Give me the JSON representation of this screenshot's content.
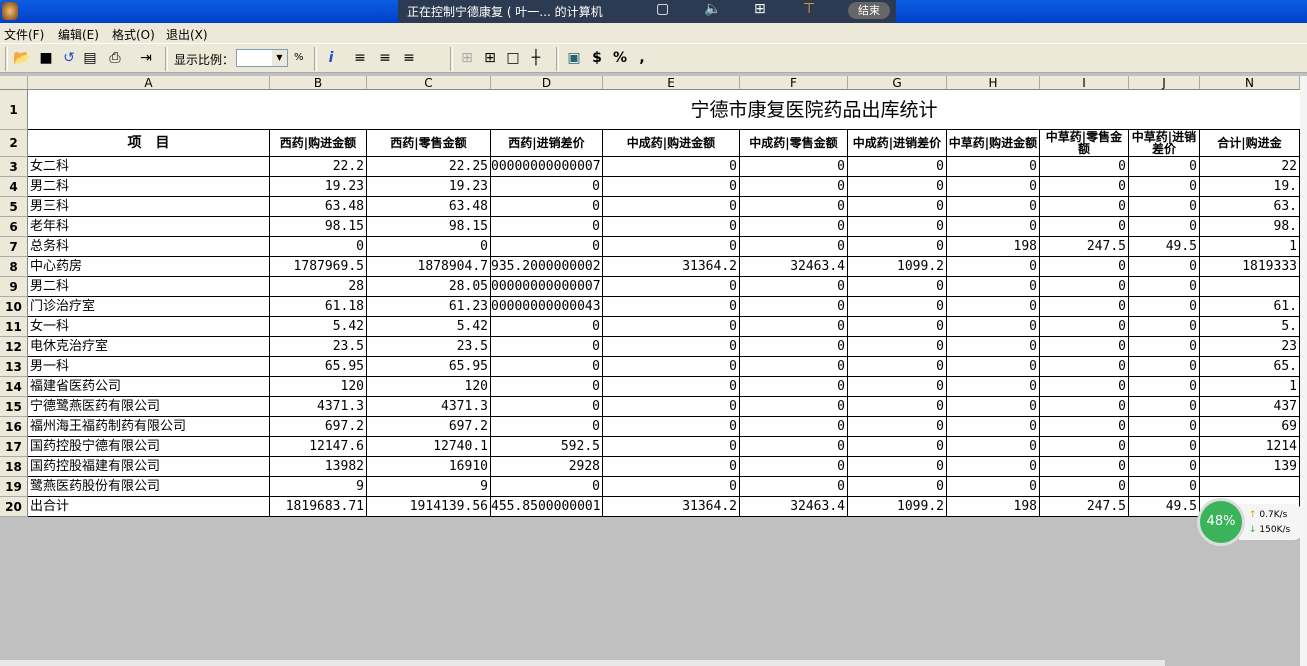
{
  "window": {
    "remote_banner": "正在控制宁德康复 ( 叶一... 的计算机",
    "end_label": "结束"
  },
  "menu": [
    "文件(F)",
    "编辑(E)",
    "格式(O)",
    "退出(X)"
  ],
  "toolbar": {
    "zoom_label": "显示比例：",
    "zoom_value": "",
    "percent": "%",
    "buttons": [
      "open",
      "save",
      "refresh",
      "print-preview",
      "print",
      "exit",
      "info",
      "align-left",
      "align-center",
      "align-right",
      "no-border",
      "all-borders",
      "outer-border",
      "inner-border",
      "calc",
      "$",
      "%",
      ","
    ]
  },
  "sheet": {
    "columns": [
      "A",
      "B",
      "C",
      "D",
      "E",
      "F",
      "G",
      "H",
      "I",
      "J",
      "N"
    ],
    "title": "宁德市康复医院药品出库统计",
    "headers": [
      "项　目",
      "西药|购进金额",
      "西药|零售金额",
      "西药|进销差价",
      "中成药|购进金额",
      "中成药|零售金额",
      "中成药|进销差价",
      "中草药|购进金额",
      "中草药|零售金额",
      "中草药|进销差价",
      "合计|购进金"
    ],
    "rows": [
      [
        "女二科",
        "22.2",
        "22.25",
        "00000000000007",
        "0",
        "0",
        "0",
        "0",
        "0",
        "0",
        "22"
      ],
      [
        "男二科",
        "19.23",
        "19.23",
        "0",
        "0",
        "0",
        "0",
        "0",
        "0",
        "0",
        "19."
      ],
      [
        "男三科",
        "63.48",
        "63.48",
        "0",
        "0",
        "0",
        "0",
        "0",
        "0",
        "0",
        "63."
      ],
      [
        "老年科",
        "98.15",
        "98.15",
        "0",
        "0",
        "0",
        "0",
        "0",
        "0",
        "0",
        "98."
      ],
      [
        "总务科",
        "0",
        "0",
        "0",
        "0",
        "0",
        "0",
        "198",
        "247.5",
        "49.5",
        "1"
      ],
      [
        "中心药房",
        "1787969.5",
        "1878904.7",
        "935.2000000002",
        "31364.2",
        "32463.4",
        "1099.2",
        "0",
        "0",
        "0",
        "1819333"
      ],
      [
        "男二科",
        "28",
        "28.05",
        "00000000000007",
        "0",
        "0",
        "0",
        "0",
        "0",
        "0",
        ""
      ],
      [
        "门诊治疗室",
        "61.18",
        "61.23",
        "00000000000043",
        "0",
        "0",
        "0",
        "0",
        "0",
        "0",
        "61."
      ],
      [
        "女一科",
        "5.42",
        "5.42",
        "0",
        "0",
        "0",
        "0",
        "0",
        "0",
        "0",
        "5."
      ],
      [
        "电休克治疗室",
        "23.5",
        "23.5",
        "0",
        "0",
        "0",
        "0",
        "0",
        "0",
        "0",
        "23"
      ],
      [
        "男一科",
        "65.95",
        "65.95",
        "0",
        "0",
        "0",
        "0",
        "0",
        "0",
        "0",
        "65."
      ],
      [
        "福建省医药公司",
        "120",
        "120",
        "0",
        "0",
        "0",
        "0",
        "0",
        "0",
        "0",
        "1"
      ],
      [
        "宁德鹭燕医药有限公司",
        "4371.3",
        "4371.3",
        "0",
        "0",
        "0",
        "0",
        "0",
        "0",
        "0",
        "437"
      ],
      [
        "福州海王福药制药有限公司",
        "697.2",
        "697.2",
        "0",
        "0",
        "0",
        "0",
        "0",
        "0",
        "0",
        "69"
      ],
      [
        "国药控股宁德有限公司",
        "12147.6",
        "12740.1",
        "592.5",
        "0",
        "0",
        "0",
        "0",
        "0",
        "0",
        "1214"
      ],
      [
        "国药控股福建有限公司",
        "13982",
        "16910",
        "2928",
        "0",
        "0",
        "0",
        "0",
        "0",
        "0",
        "139"
      ],
      [
        "鹭燕医药股份有限公司",
        "9",
        "9",
        "0",
        "0",
        "0",
        "0",
        "0",
        "0",
        "0",
        ""
      ],
      [
        "出合计",
        "1819683.71",
        "1914139.56",
        "455.8500000001",
        "31364.2",
        "32463.4",
        "1099.2",
        "198",
        "247.5",
        "49.5",
        ""
      ]
    ]
  },
  "net_widget": {
    "cpu": "48%",
    "up": "0.7K/s",
    "down": "150K/s"
  }
}
